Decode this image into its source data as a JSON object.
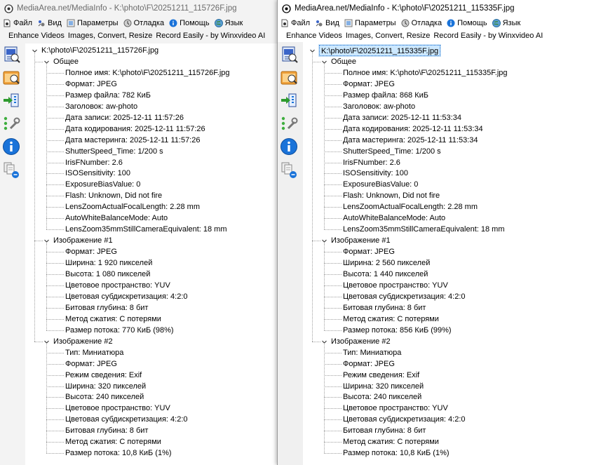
{
  "windows": [
    {
      "id": "left",
      "title": "MediaArea.net/MediaInfo - K:\\photo\\F\\20251211_115726F.jpg",
      "menu": [
        "Файл",
        "Вид",
        "Параметры",
        "Отладка",
        "Помощь",
        "Язык"
      ],
      "ads": [
        "Enhance Videos",
        "Images, Convert, Resize",
        "Record Easily - by Winxvideo AI"
      ],
      "root": "K:\\photo\\F\\20251211_115726F.jpg",
      "root_selected": false,
      "sections": [
        {
          "name": "Общее",
          "items": [
            "Полное имя: K:\\photo\\F\\20251211_115726F.jpg",
            "Формат: JPEG",
            "Размер файла: 782 КиБ",
            "Заголовок: aw-photo",
            "Дата записи: 2025-12-11 11:57:26",
            "Дата кодирования: 2025-12-11 11:57:26",
            "Дата мастеринга: 2025-12-11 11:57:26",
            "ShutterSpeed_Time: 1/200 s",
            "IrisFNumber: 2.6",
            "ISOSensitivity: 100",
            "ExposureBiasValue: 0",
            "Flash: Unknown, Did not fire",
            "LensZoomActualFocalLength: 2.28 mm",
            "AutoWhiteBalanceMode: Auto",
            "LensZoom35mmStillCameraEquivalent: 18 mm"
          ]
        },
        {
          "name": "Изображение #1",
          "items": [
            "Формат: JPEG",
            "Ширина: 1 920 пикселей",
            "Высота: 1 080 пикселей",
            "Цветовое пространство: YUV",
            "Цветовая субдискретизация: 4:2:0",
            "Битовая глубина: 8 бит",
            "Метод сжатия: С потерями",
            "Размер потока: 770 КиБ (98%)"
          ]
        },
        {
          "name": "Изображение #2",
          "items": [
            "Тип: Миниатюра",
            "Формат: JPEG",
            "Режим сведения: Exif",
            "Ширина: 320 пикселей",
            "Высота: 240 пикселей",
            "Цветовое пространство: YUV",
            "Цветовая субдискретизация: 4:2:0",
            "Битовая глубина: 8 бит",
            "Метод сжатия: С потерями",
            "Размер потока: 10,8 КиБ (1%)"
          ]
        }
      ]
    },
    {
      "id": "right",
      "title": "MediaArea.net/MediaInfo - K:\\photo\\F\\20251211_115335F.jpg",
      "menu": [
        "Файл",
        "Вид",
        "Параметры",
        "Отладка",
        "Помощь",
        "Язык"
      ],
      "ads": [
        "Enhance Videos",
        "Images, Convert, Resize",
        "Record Easily - by Winxvideo AI"
      ],
      "root": "K:\\photo\\F\\20251211_115335F.jpg",
      "root_selected": true,
      "sections": [
        {
          "name": "Общее",
          "items": [
            "Полное имя: K:\\photo\\F\\20251211_115335F.jpg",
            "Формат: JPEG",
            "Размер файла: 868 КиБ",
            "Заголовок: aw-photo",
            "Дата записи: 2025-12-11 11:53:34",
            "Дата кодирования: 2025-12-11 11:53:34",
            "Дата мастеринга: 2025-12-11 11:53:34",
            "ShutterSpeed_Time: 1/200 s",
            "IrisFNumber: 2.6",
            "ISOSensitivity: 100",
            "ExposureBiasValue: 0",
            "Flash: Unknown, Did not fire",
            "LensZoomActualFocalLength: 2.28 mm",
            "AutoWhiteBalanceMode: Auto",
            "LensZoom35mmStillCameraEquivalent: 18 mm"
          ]
        },
        {
          "name": "Изображение #1",
          "items": [
            "Формат: JPEG",
            "Ширина: 2 560 пикселей",
            "Высота: 1 440 пикселей",
            "Цветовое пространство: YUV",
            "Цветовая субдискретизация: 4:2:0",
            "Битовая глубина: 8 бит",
            "Метод сжатия: С потерями",
            "Размер потока: 856 КиБ (99%)"
          ]
        },
        {
          "name": "Изображение #2",
          "items": [
            "Тип: Миниатюра",
            "Формат: JPEG",
            "Режим сведения: Exif",
            "Ширина: 320 пикселей",
            "Высота: 240 пикселей",
            "Цветовое пространство: YUV",
            "Цветовая субдискретизация: 4:2:0",
            "Битовая глубина: 8 бит",
            "Метод сжатия: С потерями",
            "Размер потока: 10,8 КиБ (1%)"
          ]
        }
      ]
    }
  ],
  "menu_icons": [
    "file-icon",
    "view-icon",
    "settings-icon",
    "debug-icon",
    "help-icon",
    "language-icon"
  ],
  "toolbar_icons": [
    "open-file-icon",
    "open-folder-icon",
    "export-icon",
    "preferences-icon",
    "about-icon",
    "knowledge-icon"
  ],
  "colors": {
    "selection_bg": "#cce8ff",
    "selection_border": "#1e6fd0",
    "tree_line": "#a0a0a0",
    "info_blue": "#1a73d9"
  }
}
